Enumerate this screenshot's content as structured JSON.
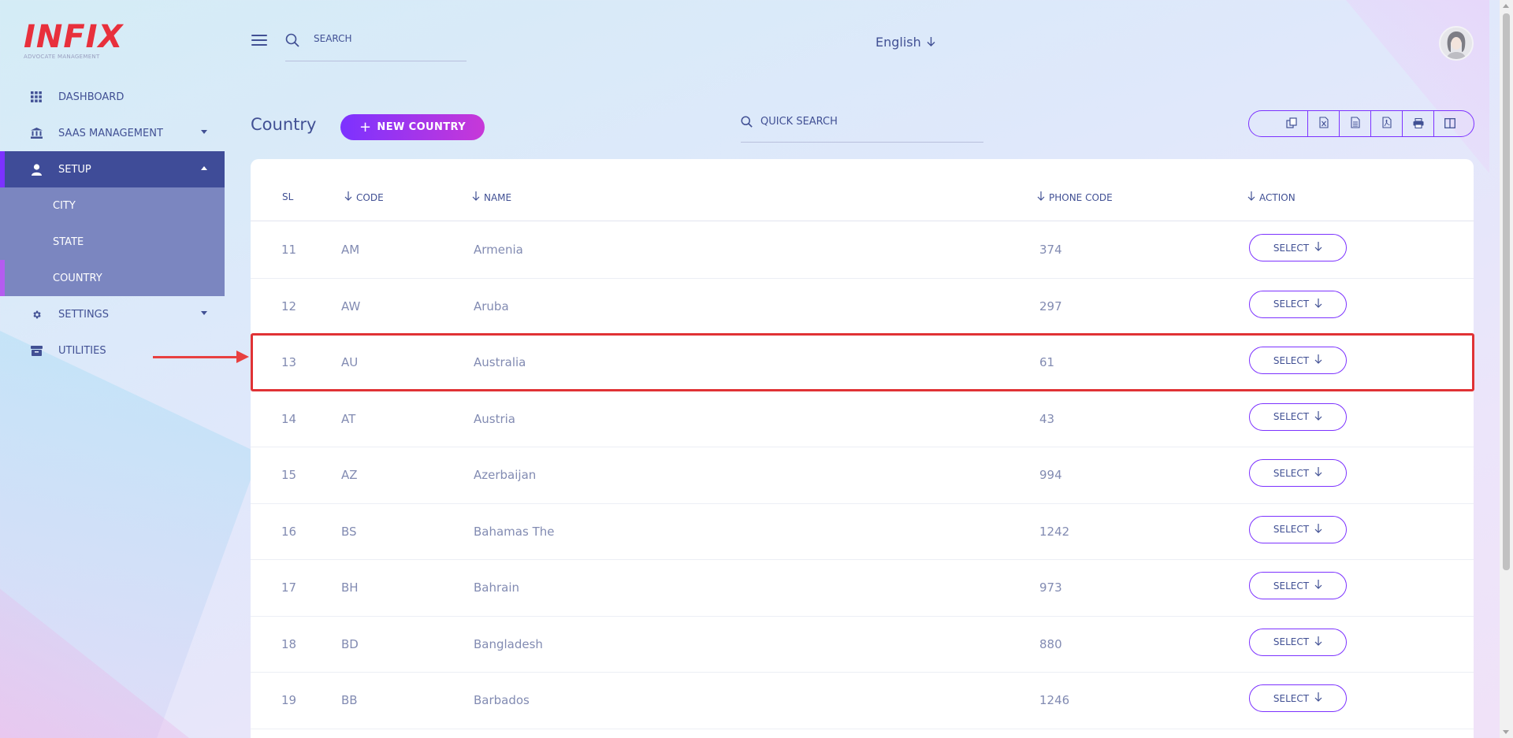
{
  "brand": {
    "logo_text": "INFIX",
    "logo_sub": "ADVOCATE MANAGEMENT"
  },
  "sidebar": {
    "items": [
      {
        "label": "DASHBOARD",
        "icon": "grid-icon"
      },
      {
        "label": "SAAS MANAGEMENT",
        "icon": "bank-icon",
        "has_caret": true
      },
      {
        "label": "SETUP",
        "icon": "user-icon",
        "has_caret": true,
        "active": true
      },
      {
        "label": "SETTINGS",
        "icon": "gear-icon",
        "has_caret": true
      },
      {
        "label": "UTILITIES",
        "icon": "archive-icon"
      }
    ],
    "setup_submenu": [
      {
        "label": "CITY"
      },
      {
        "label": "STATE"
      },
      {
        "label": "COUNTRY",
        "current": true
      }
    ]
  },
  "header": {
    "search_placeholder": "SEARCH",
    "language": "English"
  },
  "page": {
    "title": "Country",
    "new_button": "NEW COUNTRY",
    "quick_search_placeholder": "QUICK SEARCH",
    "export_buttons": [
      "copy-icon",
      "excel-icon",
      "csv-icon",
      "pdf-icon",
      "print-icon",
      "columns-icon"
    ]
  },
  "table": {
    "headers": {
      "sl": "SL",
      "code": "CODE",
      "name": "NAME",
      "phone_code": "PHONE CODE",
      "action": "ACTION"
    },
    "rows": [
      {
        "sl": "11",
        "code": "AM",
        "name": "Armenia",
        "phone_code": "374",
        "action": "SELECT"
      },
      {
        "sl": "12",
        "code": "AW",
        "name": "Aruba",
        "phone_code": "297",
        "action": "SELECT"
      },
      {
        "sl": "13",
        "code": "AU",
        "name": "Australia",
        "phone_code": "61",
        "action": "SELECT",
        "highlighted": true
      },
      {
        "sl": "14",
        "code": "AT",
        "name": "Austria",
        "phone_code": "43",
        "action": "SELECT"
      },
      {
        "sl": "15",
        "code": "AZ",
        "name": "Azerbaijan",
        "phone_code": "994",
        "action": "SELECT"
      },
      {
        "sl": "16",
        "code": "BS",
        "name": "Bahamas The",
        "phone_code": "1242",
        "action": "SELECT"
      },
      {
        "sl": "17",
        "code": "BH",
        "name": "Bahrain",
        "phone_code": "973",
        "action": "SELECT"
      },
      {
        "sl": "18",
        "code": "BD",
        "name": "Bangladesh",
        "phone_code": "880",
        "action": "SELECT"
      },
      {
        "sl": "19",
        "code": "BB",
        "name": "Barbados",
        "phone_code": "1246",
        "action": "SELECT"
      }
    ]
  },
  "colors": {
    "primary": "#415094",
    "accent": "#7c32ff",
    "accent2": "#c738d8",
    "logo": "#e8303c",
    "highlight": "#e03235"
  }
}
